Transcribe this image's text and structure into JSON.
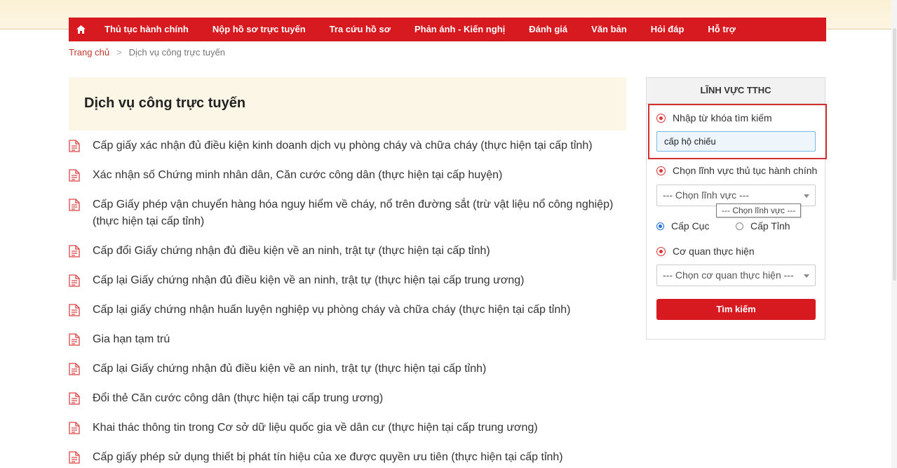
{
  "nav": {
    "home_icon": "home-icon",
    "items": [
      "Thủ tục hành chính",
      "Nộp hồ sơ trực tuyến",
      "Tra cứu hồ sơ",
      "Phản ánh - Kiến nghị",
      "Đánh giá",
      "Văn bản",
      "Hỏi đáp",
      "Hỗ trợ"
    ]
  },
  "breadcrumb": {
    "home": "Trang chủ",
    "separator": ">",
    "current": "Dịch vụ công trực tuyến"
  },
  "page": {
    "title": "Dịch vụ công trực tuyến"
  },
  "services": [
    "Cấp giấy xác nhận đủ điều kiện kinh doanh dịch vụ phòng cháy và chữa cháy (thực hiện tại cấp tỉnh)",
    "Xác nhận số Chứng minh nhân dân, Căn cước công dân (thực hiện tại cấp huyện)",
    "Cấp Giấy phép vận chuyển hàng hóa nguy hiểm về cháy, nổ trên đường sắt (trừ vật liệu nổ công nghiệp) (thực hiện tại cấp tỉnh)",
    "Cấp đổi Giấy chứng nhận đủ điều kiện về an ninh, trật tự (thực hiện tại cấp tỉnh)",
    "Cấp lại Giấy chứng nhận đủ điều kiện về an ninh, trật tự (thực hiện tại cấp trung ương)",
    "Cấp lại giấy chứng nhận huấn luyện nghiệp vụ phòng cháy và chữa cháy (thực hiện tại cấp tỉnh)",
    "Gia hạn tạm trú",
    "Cấp lại Giấy chứng nhận đủ điều kiện về an ninh, trật tự (thực hiện tại cấp tỉnh)",
    "Đổi thẻ Căn cước công dân (thực hiện tại cấp trung ương)",
    "Khai thác thông tin trong Cơ sở dữ liệu quốc gia về dân cư (thực hiện tại cấp trung ương)",
    "Cấp giấy phép sử dụng thiết bị phát tín hiệu của xe được quyền ưu tiên (thực hiện tại cấp tỉnh)"
  ],
  "sidebar": {
    "heading": "LĨNH VỰC TTHC",
    "keyword_label": "Nhập từ khóa tìm kiếm",
    "keyword_value": "cấp hộ chiếu",
    "field_label": "Chọn lĩnh vực thủ tục hành chính",
    "field_select": "--- Chọn lĩnh vực ---",
    "field_tooltip": "--- Chọn lĩnh vực ---",
    "level_cuc": "Cấp Cục",
    "level_tinh": "Cấp Tỉnh",
    "agency_label": "Cơ quan thực hiện",
    "agency_select": "--- Chọn cơ quan thực hiện ---",
    "search_button": "Tìm kiếm"
  },
  "colors": {
    "primary_red": "#d71920",
    "highlight_border": "#d32f2f",
    "title_bg": "#fbf6e6"
  }
}
